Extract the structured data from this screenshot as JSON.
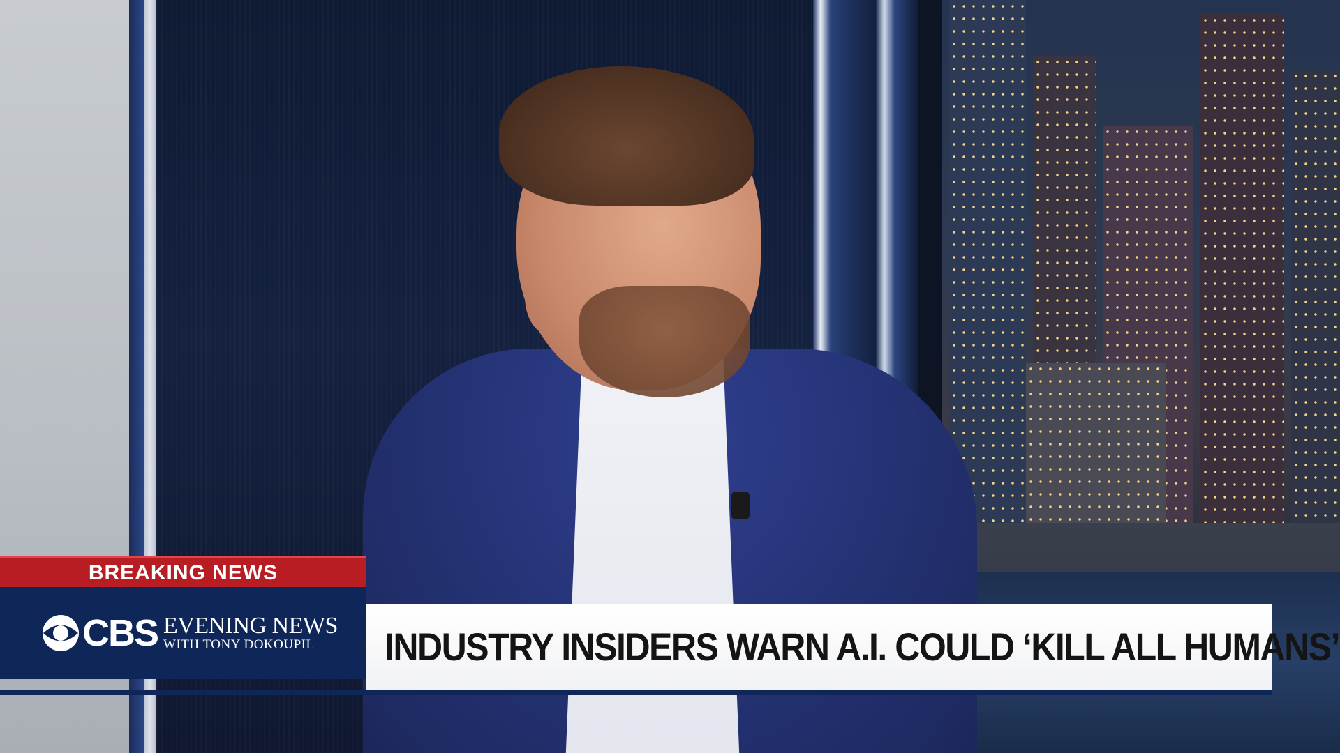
{
  "lower_third": {
    "breaking_label": "BREAKING NEWS",
    "network": "CBS",
    "show_title": "EVENING NEWS",
    "show_host": "WITH TONY DOKOUPIL",
    "headline": "INDUSTRY INSIDERS WARN A.I. COULD ‘KILL ALL HUMANS’"
  },
  "colors": {
    "breaking_red": "#b81d24",
    "brand_navy": "#0f2658",
    "headline_bg": "#ffffff",
    "headline_text": "#141414"
  },
  "icons": {
    "network_logo": "cbs-eye-icon"
  }
}
